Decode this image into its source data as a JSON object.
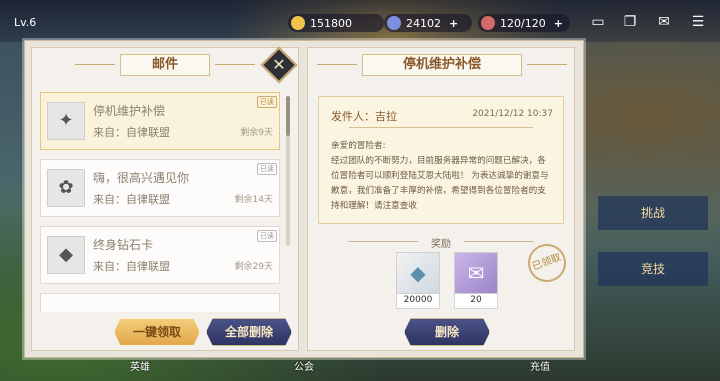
{
  "topbar": {
    "level": "Lv.6",
    "gold": "151800",
    "gems": "24102",
    "stamina": "120/120",
    "icons": [
      "gold-coin-icon",
      "gem-icon",
      "stamina-icon",
      "chat-icon",
      "journal-icon",
      "mail-icon",
      "menu-icon"
    ]
  },
  "mailbox": {
    "title": "邮件",
    "mails": [
      {
        "title": "停机维护补偿",
        "from": "来自：自律联盟",
        "remain": "剩余9天",
        "status": "已读"
      },
      {
        "title": "嗨，很高兴遇见你",
        "from": "来自：自律联盟",
        "remain": "剩余14天",
        "status": "已读"
      },
      {
        "title": "终身钻石卡",
        "from": "来自：自律联盟",
        "remain": "剩余29天",
        "status": "已读"
      }
    ],
    "claim_all_label": "一键领取",
    "delete_all_label": "全部删除"
  },
  "detail": {
    "title": "停机维护补偿",
    "sender": "发件人：吉拉",
    "date": "2021/12/12 10:37",
    "greeting": "亲爱的冒险者:",
    "body": "经过团队的不断努力，目前服务器异常的问题已解决，各位冒险者可以顺利登陆艾恩大陆啦！ 为表达诚挚的谢意与歉意，我们准备了丰厚的补偿，希望得到各位冒险者的支持和理解！请注意查收",
    "rewards_label": "奖励",
    "rewards": [
      {
        "icon": "diamond-icon",
        "count": "20000"
      },
      {
        "icon": "ticket-icon",
        "count": "20"
      }
    ],
    "claimed_stamp": "已领取",
    "delete_label": "删除"
  },
  "side": {
    "buttons": [
      "挑战",
      "竞技"
    ]
  },
  "bottom_nav": [
    "英雄",
    "",
    "公会",
    "",
    "",
    "充值"
  ],
  "colors": {
    "accent_gold": "#e2a84a",
    "navy": "#2e3563",
    "brown_text": "#8a5a2a"
  }
}
